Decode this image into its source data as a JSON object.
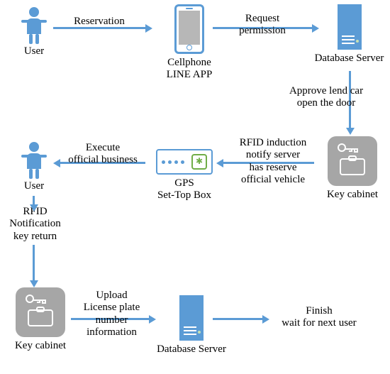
{
  "nodes": {
    "user1": "User",
    "phone_line1": "Cellphone",
    "phone_line2": "LINE APP",
    "dbserver1": "Database Server",
    "keycab1": "Key cabinet",
    "gps_line1": "GPS",
    "gps_line2": "Set-Top Box",
    "user2": "User",
    "keycab2": "Key cabinet",
    "dbserver2": "Database Server"
  },
  "labels": {
    "reservation": "Reservation",
    "request_l1": "Request",
    "request_l2": "permission",
    "approve_l1": "Approve lend car",
    "approve_l2": "open the door",
    "rfid_ind_l1": "RFID induction",
    "rfid_ind_l2": "notify server",
    "rfid_ind_l3": "has reserve",
    "rfid_ind_l4": "official vehicle",
    "execute_l1": "Execute",
    "execute_l2": "official business",
    "rfid_ret_l1": "RFID",
    "rfid_ret_l2": "Notification",
    "rfid_ret_l3": "key return",
    "upload_l1": "Upload",
    "upload_l2": "License plate",
    "upload_l3": "number",
    "upload_l4": "information",
    "finish_l1": "Finish",
    "finish_l2": "wait for next user"
  }
}
